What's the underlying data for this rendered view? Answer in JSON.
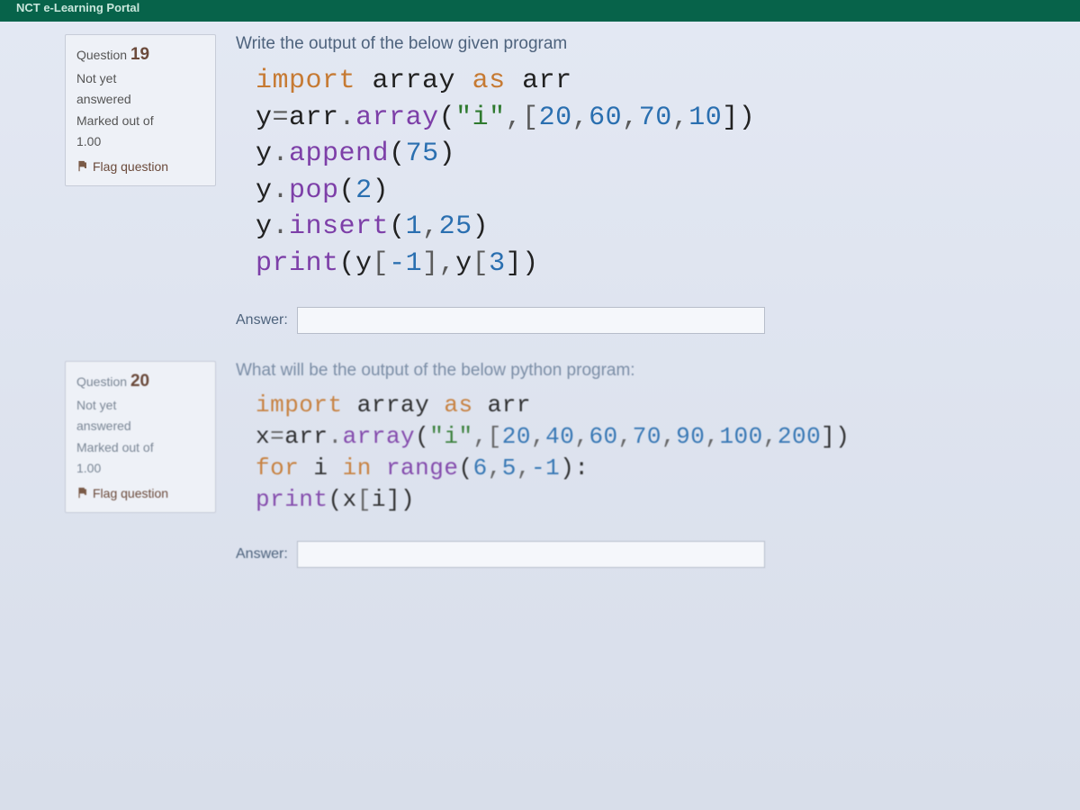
{
  "topbar": {
    "title": "NCT e-Learning Portal"
  },
  "questions": [
    {
      "label": "Question",
      "number": "19",
      "status_lines": [
        "Not yet",
        "answered"
      ],
      "marked_lines": [
        "Marked out of",
        "1.00"
      ],
      "flag_label": "Flag question",
      "prompt": "Write the output of the below given program",
      "code_lines": [
        [
          {
            "t": "import",
            "c": "kw"
          },
          {
            "t": " array ",
            "c": "nm"
          },
          {
            "t": "as",
            "c": "kw"
          },
          {
            "t": " arr",
            "c": "nm"
          }
        ],
        [
          {
            "t": "y",
            "c": "nm"
          },
          {
            "t": "=",
            "c": "op"
          },
          {
            "t": "arr",
            "c": "nm"
          },
          {
            "t": ".",
            "c": "op"
          },
          {
            "t": "array",
            "c": "fn"
          },
          {
            "t": "(",
            "c": "paren"
          },
          {
            "t": "\"i\"",
            "c": "str"
          },
          {
            "t": ",[",
            "c": "op"
          },
          {
            "t": "20",
            "c": "num"
          },
          {
            "t": ",",
            "c": "op"
          },
          {
            "t": "60",
            "c": "num"
          },
          {
            "t": ",",
            "c": "op"
          },
          {
            "t": "70",
            "c": "num"
          },
          {
            "t": ",",
            "c": "op"
          },
          {
            "t": "10",
            "c": "num"
          },
          {
            "t": "])",
            "c": "paren"
          }
        ],
        [
          {
            "t": "y",
            "c": "nm"
          },
          {
            "t": ".",
            "c": "op"
          },
          {
            "t": "append",
            "c": "fn"
          },
          {
            "t": "(",
            "c": "paren"
          },
          {
            "t": "75",
            "c": "num"
          },
          {
            "t": ")",
            "c": "paren"
          }
        ],
        [
          {
            "t": "y",
            "c": "nm"
          },
          {
            "t": ".",
            "c": "op"
          },
          {
            "t": "pop",
            "c": "fn"
          },
          {
            "t": "(",
            "c": "paren"
          },
          {
            "t": "2",
            "c": "num"
          },
          {
            "t": ")",
            "c": "paren"
          }
        ],
        [
          {
            "t": "y",
            "c": "nm"
          },
          {
            "t": ".",
            "c": "op"
          },
          {
            "t": "insert",
            "c": "fn"
          },
          {
            "t": "(",
            "c": "paren"
          },
          {
            "t": "1",
            "c": "num"
          },
          {
            "t": ",",
            "c": "op"
          },
          {
            "t": "25",
            "c": "num"
          },
          {
            "t": ")",
            "c": "paren"
          }
        ],
        [
          {
            "t": "print",
            "c": "fn"
          },
          {
            "t": "(",
            "c": "paren"
          },
          {
            "t": "y",
            "c": "nm"
          },
          {
            "t": "[",
            "c": "op"
          },
          {
            "t": "-1",
            "c": "num"
          },
          {
            "t": "],",
            "c": "op"
          },
          {
            "t": "y",
            "c": "nm"
          },
          {
            "t": "[",
            "c": "op"
          },
          {
            "t": "3",
            "c": "num"
          },
          {
            "t": "])",
            "c": "paren"
          }
        ]
      ],
      "answer_label": "Answer:",
      "answer_value": ""
    },
    {
      "label": "Question",
      "number": "20",
      "status_lines": [
        "Not yet",
        "answered"
      ],
      "marked_lines": [
        "Marked out of",
        "1.00"
      ],
      "flag_label": "Flag question",
      "prompt": "What will be the output of the below python program:",
      "code_lines": [
        [
          {
            "t": "import",
            "c": "kw"
          },
          {
            "t": " array ",
            "c": "nm"
          },
          {
            "t": "as",
            "c": "kw"
          },
          {
            "t": " arr",
            "c": "nm"
          }
        ],
        [
          {
            "t": "x",
            "c": "nm"
          },
          {
            "t": "=",
            "c": "op"
          },
          {
            "t": "arr",
            "c": "nm"
          },
          {
            "t": ".",
            "c": "op"
          },
          {
            "t": "array",
            "c": "fn"
          },
          {
            "t": "(",
            "c": "paren"
          },
          {
            "t": "\"i\"",
            "c": "str"
          },
          {
            "t": ",[",
            "c": "op"
          },
          {
            "t": "20",
            "c": "num"
          },
          {
            "t": ",",
            "c": "op"
          },
          {
            "t": "40",
            "c": "num"
          },
          {
            "t": ",",
            "c": "op"
          },
          {
            "t": "60",
            "c": "num"
          },
          {
            "t": ",",
            "c": "op"
          },
          {
            "t": "70",
            "c": "num"
          },
          {
            "t": ",",
            "c": "op"
          },
          {
            "t": "90",
            "c": "num"
          },
          {
            "t": ",",
            "c": "op"
          },
          {
            "t": "100",
            "c": "num"
          },
          {
            "t": ",",
            "c": "op"
          },
          {
            "t": "200",
            "c": "num"
          },
          {
            "t": "])",
            "c": "paren"
          }
        ],
        [
          {
            "t": "for",
            "c": "kw"
          },
          {
            "t": " i ",
            "c": "nm"
          },
          {
            "t": "in",
            "c": "kw"
          },
          {
            "t": " ",
            "c": "nm"
          },
          {
            "t": "range",
            "c": "fn"
          },
          {
            "t": "(",
            "c": "paren"
          },
          {
            "t": "6",
            "c": "num"
          },
          {
            "t": ",",
            "c": "op"
          },
          {
            "t": "5",
            "c": "num"
          },
          {
            "t": ",",
            "c": "op"
          },
          {
            "t": "-1",
            "c": "num"
          },
          {
            "t": "):",
            "c": "paren"
          }
        ],
        [
          {
            "t": "    ",
            "c": "nm"
          },
          {
            "t": "print",
            "c": "fn"
          },
          {
            "t": "(",
            "c": "paren"
          },
          {
            "t": "x",
            "c": "nm"
          },
          {
            "t": "[",
            "c": "op"
          },
          {
            "t": "i",
            "c": "nm"
          },
          {
            "t": "])",
            "c": "paren"
          }
        ]
      ],
      "answer_label": "Answer:",
      "answer_value": ""
    }
  ]
}
